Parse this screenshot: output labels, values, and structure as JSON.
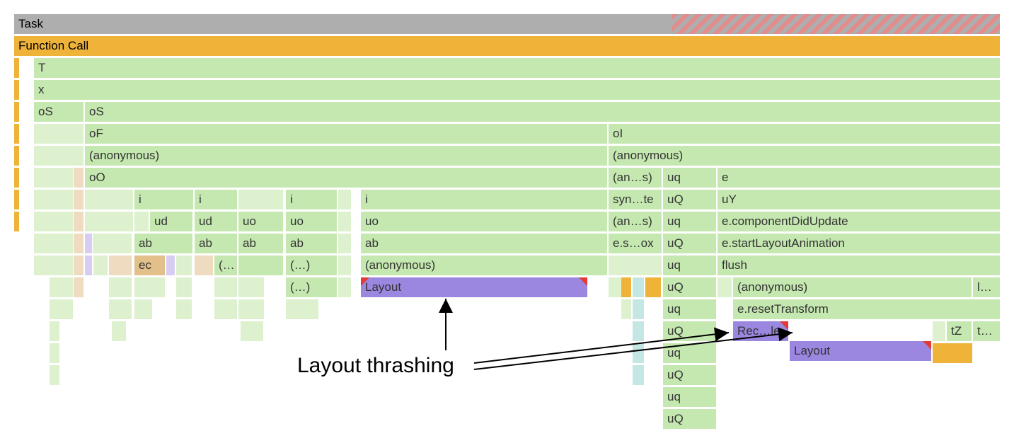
{
  "rows": {
    "r0": {
      "task": "Task"
    },
    "r1": {
      "func": "Function Call"
    },
    "r2": {
      "T": "T"
    },
    "r3": {
      "x": "x"
    },
    "r4": {
      "oS1": "oS",
      "oS2": "oS"
    },
    "r5": {
      "oF": "oF",
      "oI": "oI"
    },
    "r6": {
      "anon1": "(anonymous)",
      "anon2": "(anonymous)"
    },
    "r7": {
      "oO": "oO",
      "ans": "(an…s)",
      "uq": "uq",
      "e": "e"
    },
    "r8": {
      "i1": "i",
      "i2": "i",
      "i3": "i",
      "i4": "i",
      "syn": "syn…te",
      "uQ": "uQ",
      "uY": "uY"
    },
    "r9": {
      "ud1": "ud",
      "ud2": "ud",
      "uo1": "uo",
      "uo2": "uo",
      "uo3": "uo",
      "ans": "(an…s)",
      "uq": "uq",
      "ecdu": "e.componentDidUpdate"
    },
    "r10": {
      "ab1": "ab",
      "ab2": "ab",
      "ab3": "ab",
      "ab4": "ab",
      "ab5": "ab",
      "esox": "e.s…ox",
      "uQ": "uQ",
      "esla": "e.startLayoutAnimation"
    },
    "r11": {
      "ec": "ec",
      "el1": "(…",
      "el2": "(…)",
      "anon": "(anonymous)",
      "uq": "uq",
      "flush": "flush"
    },
    "r12": {
      "el": "(…)",
      "layout": "Layout",
      "uQ": "uQ",
      "anon": "(anonymous)",
      "ldots": "l…"
    },
    "r13": {
      "uq": "uq",
      "ert": "e.resetTransform"
    },
    "r14": {
      "uQ": "uQ",
      "rec": "Rec…le",
      "layout": "Layout",
      "tZ": "tZ",
      "tdots": "t…"
    },
    "r15": {
      "uq": "uq"
    },
    "r16": {
      "uQ": "uQ"
    },
    "r17": {
      "uq": "uq"
    },
    "r18": {
      "uQ": "uQ"
    }
  },
  "annotation": "Layout thrashing"
}
